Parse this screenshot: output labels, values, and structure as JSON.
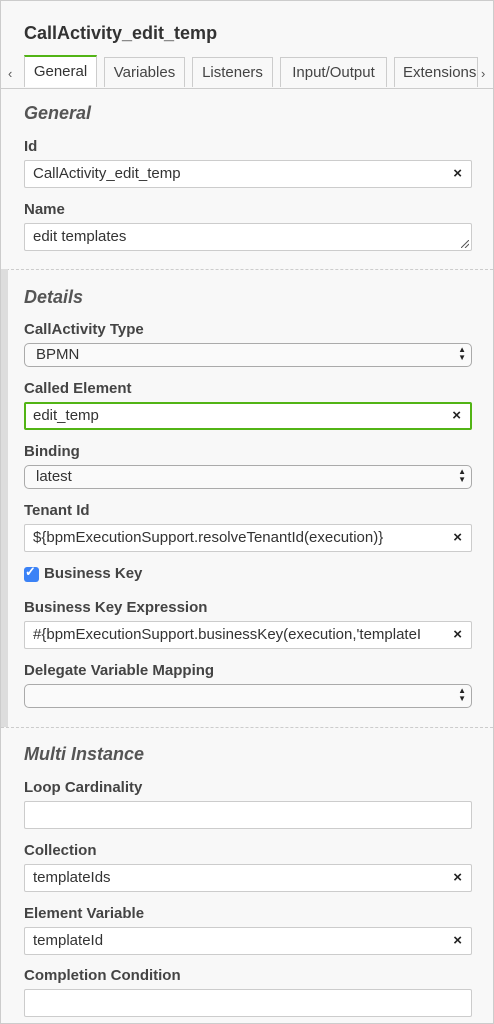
{
  "header": {
    "title": "CallActivity_edit_temp"
  },
  "tabs": {
    "left_arrow": "‹",
    "right_arrow": "›",
    "items": [
      {
        "label": "General",
        "active": true
      },
      {
        "label": "Variables"
      },
      {
        "label": "Listeners"
      },
      {
        "label": "Input/Output"
      },
      {
        "label": "Extensions"
      }
    ]
  },
  "general": {
    "heading": "General",
    "id_label": "Id",
    "id_value": "CallActivity_edit_temp",
    "name_label": "Name",
    "name_value": "edit templates"
  },
  "details": {
    "heading": "Details",
    "type_label": "CallActivity Type",
    "type_value": "BPMN",
    "called_label": "Called Element",
    "called_value": "edit_temp",
    "binding_label": "Binding",
    "binding_value": "latest",
    "tenant_label": "Tenant Id",
    "tenant_value": "${bpmExecutionSupport.resolveTenantId(execution)}",
    "business_key_label": "Business Key",
    "business_key_checked": true,
    "bk_expr_label": "Business Key Expression",
    "bk_expr_value": "#{bpmExecutionSupport.businessKey(execution,'templateI",
    "delegate_label": "Delegate Variable Mapping",
    "delegate_value": ""
  },
  "multi": {
    "heading": "Multi Instance",
    "loop_label": "Loop Cardinality",
    "loop_value": "",
    "collection_label": "Collection",
    "collection_value": "templateIds",
    "element_var_label": "Element Variable",
    "element_var_value": "templateId",
    "completion_label": "Completion Condition",
    "completion_value": ""
  },
  "icons": {
    "clear": "×",
    "checkmark": "✓"
  },
  "colors": {
    "accent_green": "#52b415",
    "checkbox_blue": "#3b82f6"
  }
}
